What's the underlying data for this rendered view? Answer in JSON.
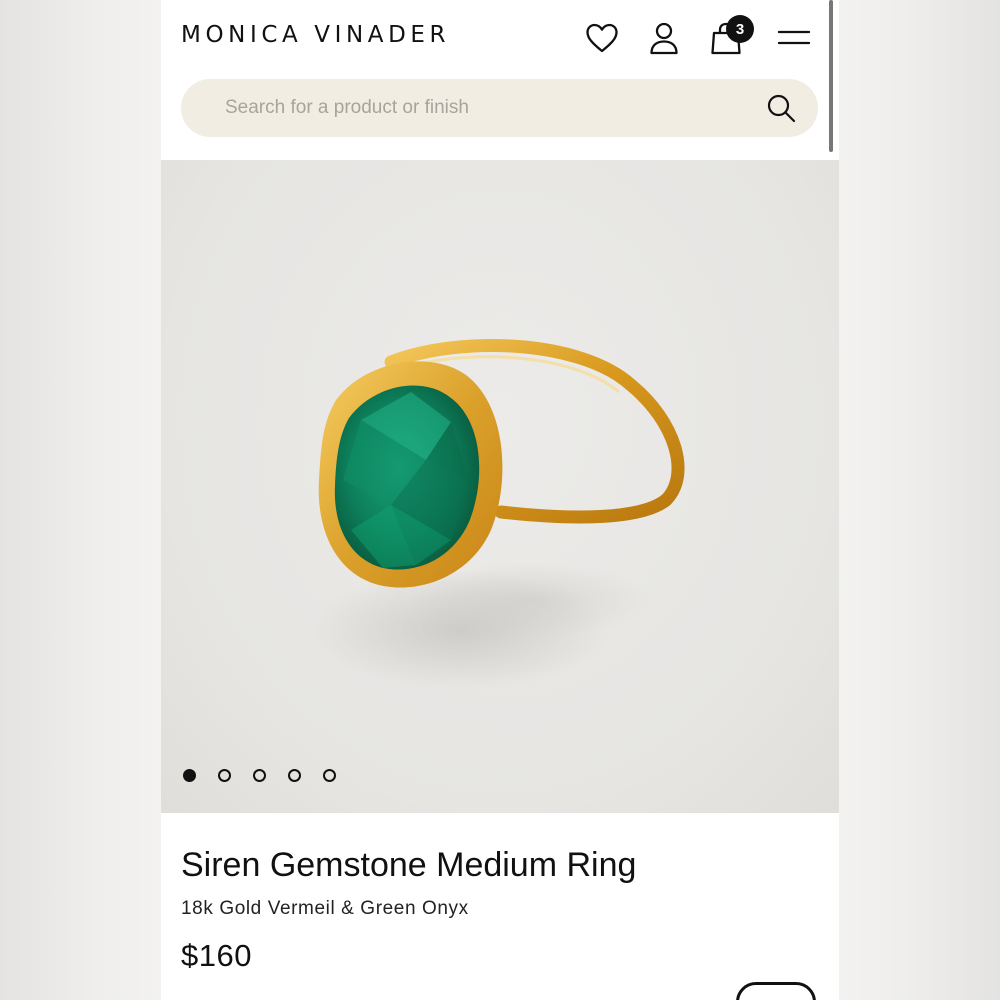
{
  "brand": {
    "logo": "MONICA VINADER"
  },
  "header": {
    "icons": [
      "heart-icon",
      "user-icon",
      "bag-icon",
      "menu-icon"
    ],
    "bag_count": "3"
  },
  "search": {
    "placeholder": "Search for a product or finish"
  },
  "gallery": {
    "image_count": 5,
    "active_index": 0
  },
  "product": {
    "title": "Siren Gemstone Medium Ring",
    "subtitle": "18k Gold Vermeil & Green Onyx",
    "price": "$160"
  },
  "colors": {
    "search_bg": "#f1ede3",
    "gold": "#d9a22a",
    "gem": "#0f8a63",
    "text": "#111111"
  }
}
